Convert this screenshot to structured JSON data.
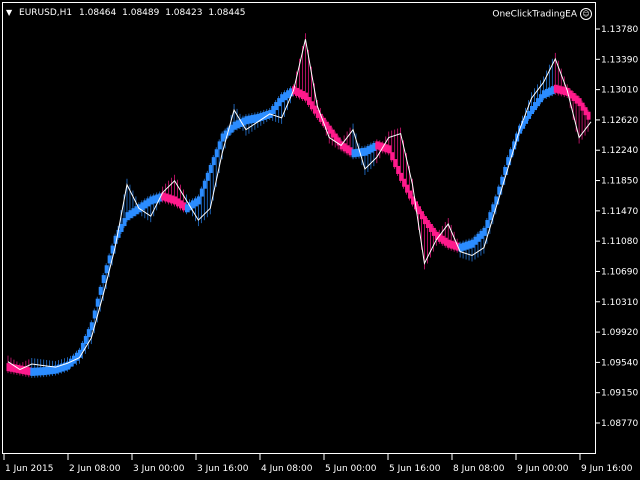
{
  "header": {
    "menu_arrow": "▼",
    "symbol": "EURUSD,H1",
    "open": "1.08464",
    "high": "1.08489",
    "low": "1.08423",
    "close": "1.08445"
  },
  "ea": {
    "name": "OneClickTradingEA",
    "icon": "smiley-icon"
  },
  "colors": {
    "background": "#000000",
    "up": "#2b8cff",
    "down": "#ff1a8c",
    "price_line": "#ffffff"
  },
  "chart_data": {
    "type": "line",
    "price_axis": [
      "1.13780",
      "1.13390",
      "1.13010",
      "1.12620",
      "1.12240",
      "1.11850",
      "1.11470",
      "1.11080",
      "1.10690",
      "1.10310",
      "1.09920",
      "1.09540",
      "1.09150",
      "1.08770"
    ],
    "time_axis": [
      "1 Jun 2015",
      "2 Jun 08:00",
      "3 Jun 00:00",
      "3 Jun 16:00",
      "4 Jun 08:00",
      "5 Jun 00:00",
      "5 Jun 16:00",
      "8 Jun 08:00",
      "9 Jun 00:00",
      "9 Jun 16:00"
    ],
    "ylim": [
      1.0877,
      1.1378
    ],
    "price": [
      1.0955,
      1.0945,
      1.0952,
      1.095,
      1.0948,
      1.0953,
      1.096,
      1.0985,
      1.104,
      1.11,
      1.118,
      1.115,
      1.114,
      1.117,
      1.1185,
      1.116,
      1.1135,
      1.115,
      1.122,
      1.1275,
      1.125,
      1.126,
      1.127,
      1.1265,
      1.13,
      1.1365,
      1.128,
      1.124,
      1.123,
      1.125,
      1.12,
      1.1215,
      1.124,
      1.1245,
      1.118,
      1.108,
      1.111,
      1.113,
      1.1095,
      1.109,
      1.11,
      1.115,
      1.12,
      1.125,
      1.129,
      1.131,
      1.134,
      1.13,
      1.124,
      1.126
    ],
    "smooth": [
      1.0948,
      1.0945,
      1.0942,
      1.0943,
      1.0945,
      1.095,
      1.0965,
      1.1,
      1.106,
      1.111,
      1.114,
      1.115,
      1.116,
      1.1165,
      1.116,
      1.115,
      1.116,
      1.12,
      1.124,
      1.1255,
      1.1262,
      1.1265,
      1.127,
      1.129,
      1.13,
      1.1292,
      1.127,
      1.125,
      1.123,
      1.122,
      1.1222,
      1.123,
      1.1225,
      1.119,
      1.116,
      1.1135,
      1.1115,
      1.1105,
      1.11,
      1.1105,
      1.112,
      1.116,
      1.121,
      1.125,
      1.1275,
      1.1295,
      1.1302,
      1.1298,
      1.1285,
      1.1262
    ]
  }
}
